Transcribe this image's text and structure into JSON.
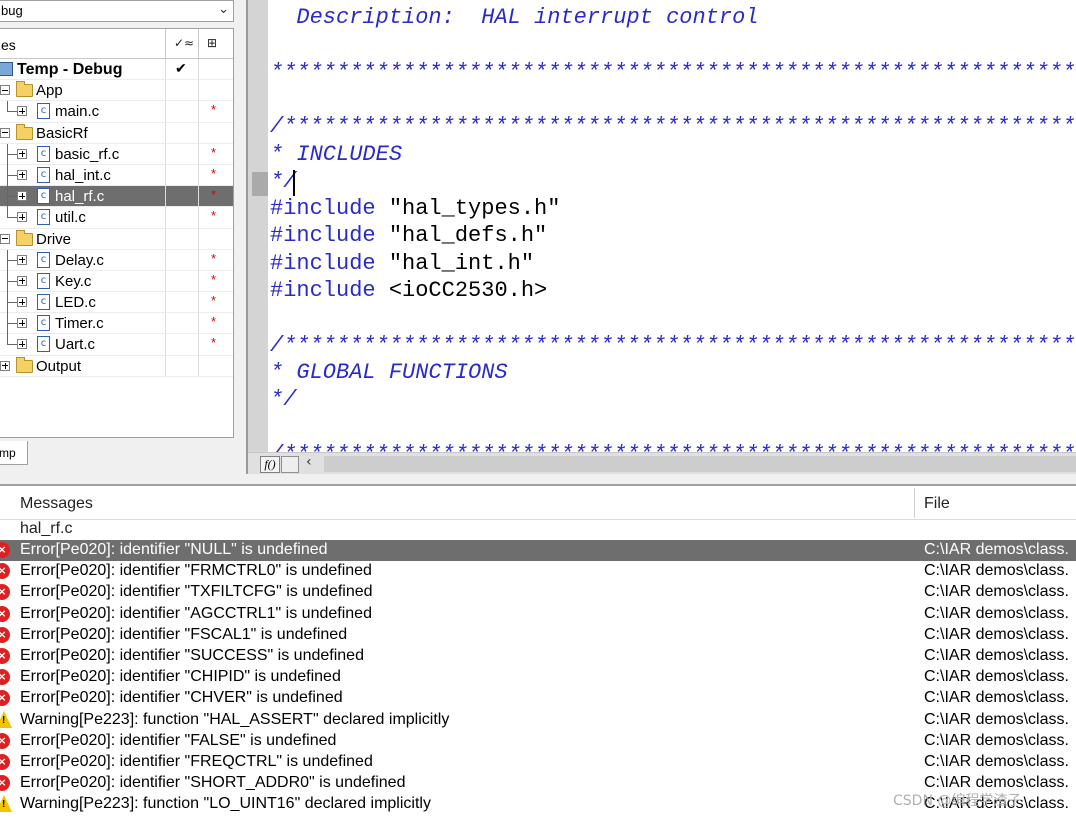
{
  "workspace": {
    "config": "bug",
    "header": {
      "files": "es"
    },
    "project": "Temp - Debug",
    "project_check": "✔",
    "tree": [
      {
        "label": "App",
        "type": "folder",
        "level": 0
      },
      {
        "label": "main.c",
        "type": "file",
        "level": 1,
        "modified": "*"
      },
      {
        "label": "BasicRf",
        "type": "folder",
        "level": 0
      },
      {
        "label": "basic_rf.c",
        "type": "file",
        "level": 1,
        "modified": "*"
      },
      {
        "label": "hal_int.c",
        "type": "file",
        "level": 1,
        "modified": "*"
      },
      {
        "label": "hal_rf.c",
        "type": "file",
        "level": 1,
        "modified": "*",
        "selected": true
      },
      {
        "label": "util.c",
        "type": "file",
        "level": 1,
        "modified": "*"
      },
      {
        "label": "Drive",
        "type": "folder",
        "level": 0
      },
      {
        "label": "Delay.c",
        "type": "file",
        "level": 1,
        "modified": "*"
      },
      {
        "label": "Key.c",
        "type": "file",
        "level": 1,
        "modified": "*"
      },
      {
        "label": "LED.c",
        "type": "file",
        "level": 1,
        "modified": "*"
      },
      {
        "label": "Timer.c",
        "type": "file",
        "level": 1,
        "modified": "*"
      },
      {
        "label": "Uart.c",
        "type": "file",
        "level": 1,
        "modified": "*"
      },
      {
        "label": "Output",
        "type": "folder",
        "level": 0
      }
    ],
    "tab": "mp"
  },
  "editor": {
    "lines": [
      {
        "kind": "comment",
        "text": "  Description:  HAL interrupt control"
      },
      {
        "kind": "blank",
        "text": ""
      },
      {
        "kind": "comment",
        "text": "*************************************************************"
      },
      {
        "kind": "blank",
        "text": ""
      },
      {
        "kind": "comment",
        "text": "/************************************************************"
      },
      {
        "kind": "comment",
        "text": "* INCLUDES"
      },
      {
        "kind": "comment",
        "text": "*/"
      },
      {
        "kind": "include",
        "directive": "#include",
        "text": " \"hal_types.h\""
      },
      {
        "kind": "include",
        "directive": "#include",
        "text": " \"hal_defs.h\""
      },
      {
        "kind": "include",
        "directive": "#include",
        "text": " \"hal_int.h\""
      },
      {
        "kind": "include",
        "directive": "#include",
        "text": " <ioCC2530.h>"
      },
      {
        "kind": "blank",
        "text": ""
      },
      {
        "kind": "comment",
        "text": "/************************************************************"
      },
      {
        "kind": "comment",
        "text": "* GLOBAL FUNCTIONS"
      },
      {
        "kind": "comment",
        "text": "*/"
      },
      {
        "kind": "blank",
        "text": ""
      },
      {
        "kind": "comment",
        "text": "/************************************************************"
      }
    ],
    "func_button": "f()"
  },
  "messages": {
    "header": {
      "messages": "Messages",
      "file": "File"
    },
    "current_file": "hal_rf.c",
    "rows": [
      {
        "severity": "error",
        "text": "Error[Pe020]: identifier \"NULL\" is undefined",
        "path": "C:\\IAR demos\\class.",
        "selected": true
      },
      {
        "severity": "error",
        "text": "Error[Pe020]: identifier \"FRMCTRL0\" is undefined",
        "path": "C:\\IAR demos\\class."
      },
      {
        "severity": "error",
        "text": "Error[Pe020]: identifier \"TXFILTCFG\" is undefined",
        "path": "C:\\IAR demos\\class."
      },
      {
        "severity": "error",
        "text": "Error[Pe020]: identifier \"AGCCTRL1\" is undefined",
        "path": "C:\\IAR demos\\class."
      },
      {
        "severity": "error",
        "text": "Error[Pe020]: identifier \"FSCAL1\" is undefined",
        "path": "C:\\IAR demos\\class."
      },
      {
        "severity": "error",
        "text": "Error[Pe020]: identifier \"SUCCESS\" is undefined",
        "path": "C:\\IAR demos\\class."
      },
      {
        "severity": "error",
        "text": "Error[Pe020]: identifier \"CHIPID\" is undefined",
        "path": "C:\\IAR demos\\class."
      },
      {
        "severity": "error",
        "text": "Error[Pe020]: identifier \"CHVER\" is undefined",
        "path": "C:\\IAR demos\\class."
      },
      {
        "severity": "warning",
        "text": "Warning[Pe223]: function \"HAL_ASSERT\" declared implicitly",
        "path": "C:\\IAR demos\\class."
      },
      {
        "severity": "error",
        "text": "Error[Pe020]: identifier \"FALSE\" is undefined",
        "path": "C:\\IAR demos\\class."
      },
      {
        "severity": "error",
        "text": "Error[Pe020]: identifier \"FREQCTRL\" is undefined",
        "path": "C:\\IAR demos\\class."
      },
      {
        "severity": "error",
        "text": "Error[Pe020]: identifier \"SHORT_ADDR0\" is undefined",
        "path": "C:\\IAR demos\\class."
      },
      {
        "severity": "warning",
        "text": "Warning[Pe223]: function \"LO_UINT16\" declared implicitly",
        "path": "C:\\IAR demos\\class."
      }
    ],
    "watermark": "CSDN @编程学渣子"
  },
  "colors": {
    "selection": "#6e6e6e",
    "comment": "#2a2ac8",
    "error": "#e02020",
    "warning": "#f5c400",
    "modified_marker": "#d00000"
  }
}
